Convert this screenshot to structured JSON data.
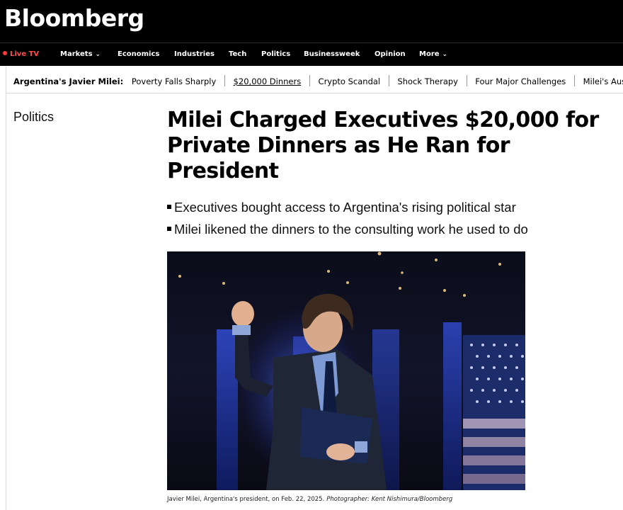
{
  "brand": {
    "logo": "Bloomberg"
  },
  "nav": {
    "live": "Live TV",
    "items": [
      "Markets",
      "Economics",
      "Industries",
      "Tech",
      "Politics",
      "Businessweek",
      "Opinion",
      "More"
    ]
  },
  "topics": {
    "label": "Argentina's Javier Milei:",
    "links": [
      "Poverty Falls Sharply",
      "$20,000 Dinners",
      "Crypto Scandal",
      "Shock Therapy",
      "Four Major Challenges",
      "Milei's Aus"
    ]
  },
  "article": {
    "section": "Politics",
    "headline": "Milei Charged Executives $20,000 for Private Dinners as He Ran for President",
    "bullets": [
      "Executives bought access to Argentina's rising political star",
      "Milei likened the dinners to the consulting work he used to do"
    ],
    "caption": "Javier Milei, Argentina's president, on Feb. 22, 2025.",
    "credit": "Photographer: Kent Nishimura/Bloomberg"
  },
  "colors": {
    "masthead": "#000000",
    "live": "#ff3b3b",
    "accent_stage": "#1f3fd6"
  }
}
